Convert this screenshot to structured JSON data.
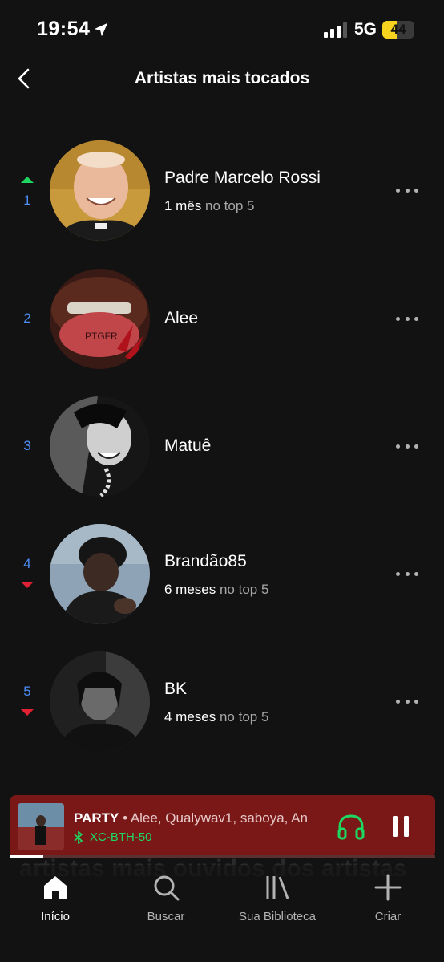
{
  "status_bar": {
    "time": "19:54",
    "network": "5G",
    "battery": "44",
    "battery_level": 0.44
  },
  "header": {
    "title": "Artistas mais tocados"
  },
  "artists": [
    {
      "rank": "1",
      "trend": "up",
      "name": "Padre Marcelo Rossi",
      "sub_strong": "1 mês",
      "sub_dim": " no top 5"
    },
    {
      "rank": "2",
      "trend": "none",
      "name": "Alee",
      "sub_strong": "",
      "sub_dim": ""
    },
    {
      "rank": "3",
      "trend": "none",
      "name": "Matuê",
      "sub_strong": "",
      "sub_dim": ""
    },
    {
      "rank": "4",
      "trend": "down",
      "name": "Brandão85",
      "sub_strong": "6 meses",
      "sub_dim": " no top 5"
    },
    {
      "rank": "5",
      "trend": "down",
      "name": "BK",
      "sub_strong": "4 meses",
      "sub_dim": " no top 5"
    }
  ],
  "background_text": "artistas mais ouvidos dos artistas",
  "mini_player": {
    "title": "PARTY",
    "artists": " • Alee, Qualywav1, saboya, An",
    "device": "XC-BTH-50",
    "progress": 0.08
  },
  "nav": {
    "home": "Início",
    "search": "Buscar",
    "library": "Sua Biblioteca",
    "create": "Criar"
  },
  "colors": {
    "background": "#121212",
    "accent_green": "#1ed760",
    "rank_blue": "#4b8ef7",
    "trend_down": "#e22134",
    "mini_player_bg": "#7a1818"
  }
}
